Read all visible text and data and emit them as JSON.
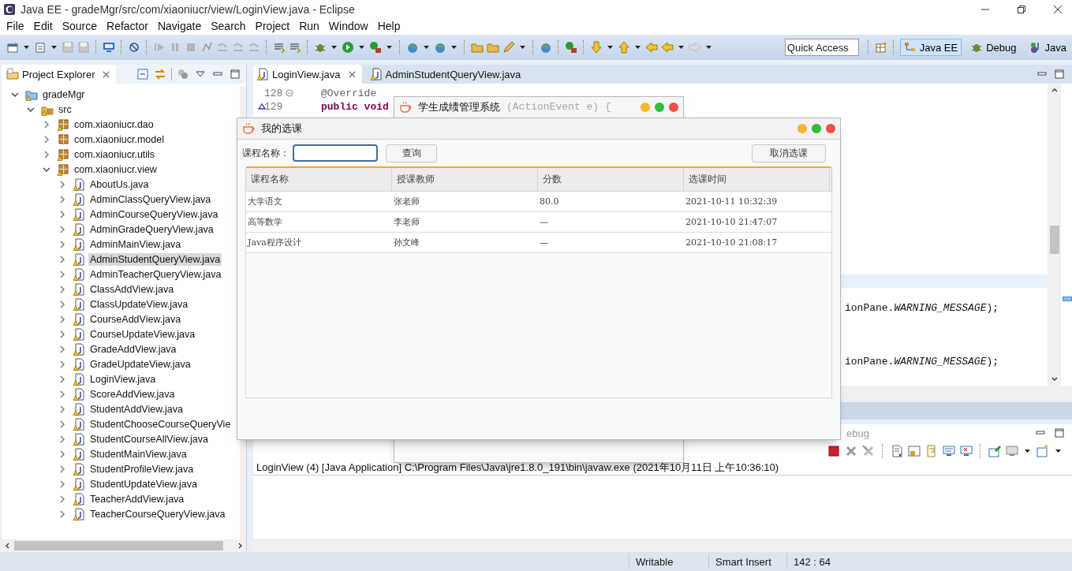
{
  "window": {
    "title": "Java EE - gradeMgr/src/com/xiaoniucr/view/LoginView.java - Eclipse"
  },
  "menu": [
    "File",
    "Edit",
    "Source",
    "Refactor",
    "Navigate",
    "Search",
    "Project",
    "Run",
    "Window",
    "Help"
  ],
  "quick_access": {
    "placeholder": "Quick Access"
  },
  "perspectives": [
    {
      "label": "Java EE",
      "selected": true
    },
    {
      "label": "Debug",
      "selected": false
    },
    {
      "label": "Java",
      "selected": false
    }
  ],
  "project_explorer": {
    "title": "Project Explorer",
    "tree": [
      {
        "label": "gradeMgr",
        "kind": "project",
        "warning": true,
        "expanded": true,
        "selected": false,
        "children": [
          {
            "label": "src",
            "kind": "folder",
            "warning": true,
            "expanded": true,
            "selected": false,
            "children": [
              {
                "label": "com.xiaoniucr.dao",
                "kind": "package",
                "warning": true,
                "expanded": false,
                "selected": false
              },
              {
                "label": "com.xiaoniucr.model",
                "kind": "package",
                "warning": false,
                "expanded": false,
                "selected": false
              },
              {
                "label": "com.xiaoniucr.utils",
                "kind": "package",
                "warning": true,
                "expanded": false,
                "selected": false
              },
              {
                "label": "com.xiaoniucr.view",
                "kind": "package",
                "warning": true,
                "expanded": true,
                "selected": false,
                "children": [
                  {
                    "label": "AboutUs.java",
                    "kind": "file",
                    "warning": true,
                    "expanded": false,
                    "selected": false
                  },
                  {
                    "label": "AdminClassQueryView.java",
                    "kind": "file",
                    "warning": true,
                    "expanded": false,
                    "selected": false
                  },
                  {
                    "label": "AdminCourseQueryView.java",
                    "kind": "file",
                    "warning": true,
                    "expanded": false,
                    "selected": false
                  },
                  {
                    "label": "AdminGradeQueryView.java",
                    "kind": "file",
                    "warning": true,
                    "expanded": false,
                    "selected": false
                  },
                  {
                    "label": "AdminMainView.java",
                    "kind": "file",
                    "warning": true,
                    "expanded": false,
                    "selected": false
                  },
                  {
                    "label": "AdminStudentQueryView.java",
                    "kind": "file",
                    "warning": true,
                    "expanded": false,
                    "selected": true
                  },
                  {
                    "label": "AdminTeacherQueryView.java",
                    "kind": "file",
                    "warning": true,
                    "expanded": false,
                    "selected": false
                  },
                  {
                    "label": "ClassAddView.java",
                    "kind": "file",
                    "warning": true,
                    "expanded": false,
                    "selected": false
                  },
                  {
                    "label": "ClassUpdateView.java",
                    "kind": "file",
                    "warning": true,
                    "expanded": false,
                    "selected": false
                  },
                  {
                    "label": "CourseAddView.java",
                    "kind": "file",
                    "warning": true,
                    "expanded": false,
                    "selected": false
                  },
                  {
                    "label": "CourseUpdateView.java",
                    "kind": "file",
                    "warning": true,
                    "expanded": false,
                    "selected": false
                  },
                  {
                    "label": "GradeAddView.java",
                    "kind": "file",
                    "warning": true,
                    "expanded": false,
                    "selected": false
                  },
                  {
                    "label": "GradeUpdateView.java",
                    "kind": "file",
                    "warning": true,
                    "expanded": false,
                    "selected": false
                  },
                  {
                    "label": "LoginView.java",
                    "kind": "file",
                    "warning": true,
                    "expanded": false,
                    "selected": false
                  },
                  {
                    "label": "ScoreAddView.java",
                    "kind": "file",
                    "warning": true,
                    "expanded": false,
                    "selected": false
                  },
                  {
                    "label": "StudentAddView.java",
                    "kind": "file",
                    "warning": true,
                    "expanded": false,
                    "selected": false
                  },
                  {
                    "label": "StudentChooseCourseQueryVie",
                    "kind": "file",
                    "warning": true,
                    "expanded": false,
                    "selected": false
                  },
                  {
                    "label": "StudentCourseAllView.java",
                    "kind": "file",
                    "warning": true,
                    "expanded": false,
                    "selected": false
                  },
                  {
                    "label": "StudentMainView.java",
                    "kind": "file",
                    "warning": true,
                    "expanded": false,
                    "selected": false
                  },
                  {
                    "label": "StudentProfileView.java",
                    "kind": "file",
                    "warning": true,
                    "expanded": false,
                    "selected": false
                  },
                  {
                    "label": "StudentUpdateView.java",
                    "kind": "file",
                    "warning": true,
                    "expanded": false,
                    "selected": false
                  },
                  {
                    "label": "TeacherAddView.java",
                    "kind": "file",
                    "warning": true,
                    "expanded": false,
                    "selected": false
                  },
                  {
                    "label": "TeacherCourseQueryView.java",
                    "kind": "file",
                    "warning": true,
                    "expanded": false,
                    "selected": false
                  }
                ]
              }
            ]
          }
        ]
      }
    ]
  },
  "editor": {
    "tabs": [
      {
        "label": "LoginView.java",
        "selected": true
      },
      {
        "label": "AdminStudentQueryView.java",
        "selected": false
      }
    ],
    "lines": [
      {
        "number": "128",
        "text": "@Override",
        "kind": "annotation"
      },
      {
        "number": "129",
        "text": "public void",
        "tail": "(ActionEvent e) {",
        "kind": "keyword"
      },
      {
        "text": "ionPane.*WARNING_MESSAGE*);",
        "kind": "plain"
      },
      {
        "text": "ionPane.*WARNING_MESSAGE*);",
        "kind": "plain"
      }
    ]
  },
  "console": {
    "tab": "ebug",
    "output": "LoginView (4) [Java Application] C:\\Program Files\\Java\\jre1.8.0_191\\bin\\javaw.exe (2021年10月11日 上午10:36:10)"
  },
  "status_bar": [
    "Writable",
    "Smart Insert",
    "142 : 64"
  ],
  "back_dialog": {
    "title": "学生成绩管理系统"
  },
  "course_dialog": {
    "title": "我的选课",
    "search_label": "课程名称：",
    "search_button": "查询",
    "cancel_button": "取消选课",
    "table": {
      "columns": [
        "课程名称",
        "授课教师",
        "分数",
        "选课时间"
      ],
      "rows": [
        [
          "大学语文",
          "张老师",
          "80.0",
          "2021-10-11 10:32:39"
        ],
        [
          "高等数学",
          "李老师",
          "—",
          "2021-10-10 21:47:07"
        ],
        [
          "Java程序设计",
          "孙文峰",
          "—",
          "2021-10-10 21:08:17"
        ]
      ]
    }
  }
}
